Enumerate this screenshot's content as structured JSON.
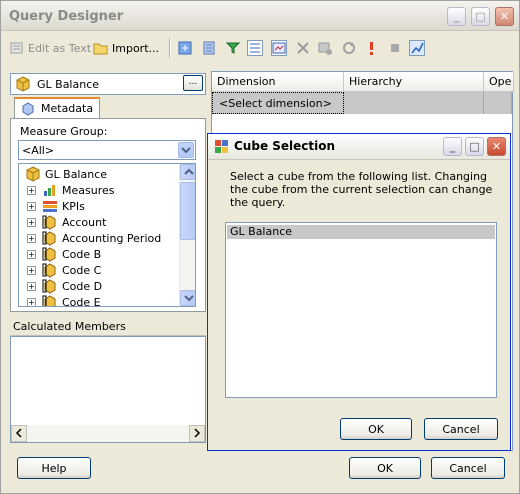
{
  "window": {
    "title": "Query Designer"
  },
  "toolbar": {
    "edit_as_text": "Edit as Text",
    "import": "Import..."
  },
  "left": {
    "cube_name": "GL Balance",
    "browse_label": "...",
    "metadata_tab": "Metadata",
    "measure_group_label": "Measure Group:",
    "measure_group_value": "<All>",
    "tree": [
      {
        "label": "GL Balance",
        "icon": "cube-icon",
        "expandable": false
      },
      {
        "label": "Measures",
        "icon": "measures-icon",
        "expandable": true
      },
      {
        "label": "KPIs",
        "icon": "kpis-icon",
        "expandable": true
      },
      {
        "label": "Account",
        "icon": "dimension-icon",
        "expandable": true
      },
      {
        "label": "Accounting Period",
        "icon": "dimension-icon",
        "expandable": true
      },
      {
        "label": "Code B",
        "icon": "dimension-icon",
        "expandable": true
      },
      {
        "label": "Code C",
        "icon": "dimension-icon",
        "expandable": true
      },
      {
        "label": "Code D",
        "icon": "dimension-icon",
        "expandable": true
      },
      {
        "label": "Code E",
        "icon": "dimension-icon",
        "expandable": true
      }
    ],
    "calculated_members": "Calculated Members"
  },
  "grid": {
    "columns": [
      "Dimension",
      "Hierarchy",
      "Ope"
    ],
    "placeholder": "<Select dimension>"
  },
  "dialog": {
    "title": "Cube Selection",
    "description": "Select a cube from the following list. Changing the cube from the current selection can change the query.",
    "items": [
      "GL Balance"
    ],
    "ok": "OK",
    "cancel": "Cancel"
  },
  "footer": {
    "help": "Help",
    "ok": "OK",
    "cancel": "Cancel"
  },
  "colors": {
    "window_bg": "#ece9d8",
    "selection": "#c8c8c8",
    "tab_accent": "#e68b2c",
    "close_button": "#d28874"
  }
}
